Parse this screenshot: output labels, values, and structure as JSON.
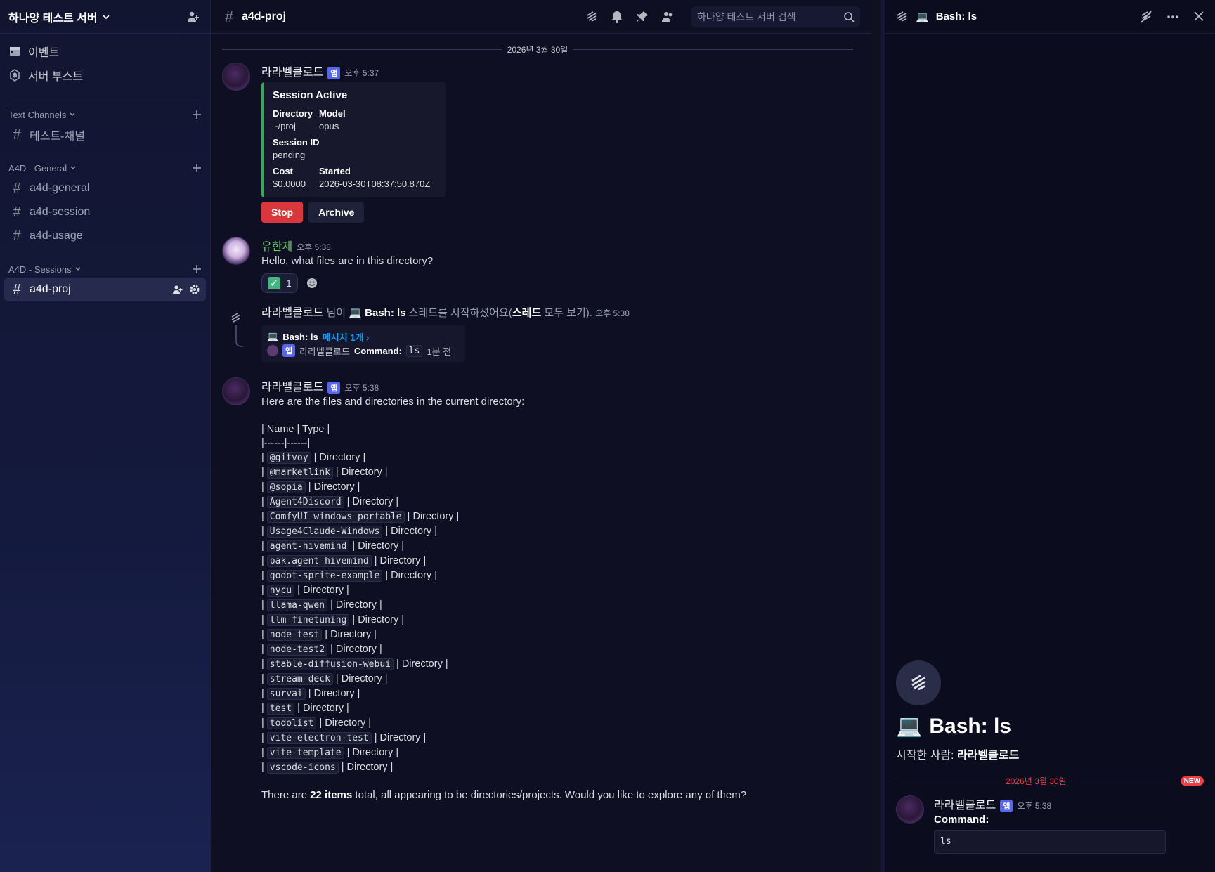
{
  "sidebar": {
    "server_name": "하나양 테스트 서버",
    "top_items": [
      {
        "label": "이벤트",
        "icon": "calendar-icon"
      },
      {
        "label": "서버 부스트",
        "icon": "boost-icon"
      }
    ],
    "categories": [
      {
        "label": "Text Channels",
        "channels": [
          "테스트-채널"
        ]
      },
      {
        "label": "A4D - General",
        "channels": [
          "a4d-general",
          "a4d-session",
          "a4d-usage"
        ]
      },
      {
        "label": "A4D - Sessions",
        "channels": [
          "a4d-proj"
        ]
      }
    ]
  },
  "header": {
    "channel": "a4d-proj",
    "search_placeholder": "하나양 테스트 서버 검색"
  },
  "messages": {
    "date_sep": "2026년 3월 30일",
    "m1": {
      "author": "라라벨클로드",
      "badge": "앱",
      "time": "오후 5:37",
      "embed": {
        "title": "Session Active",
        "directory_label": "Directory",
        "directory": "~/proj",
        "model_label": "Model",
        "model": "opus",
        "session_label": "Session ID",
        "session": "pending",
        "cost_label": "Cost",
        "cost": "$0.0000",
        "started_label": "Started",
        "started": "2026-03-30T08:37:50.870Z"
      },
      "stop": "Stop",
      "archive": "Archive"
    },
    "m2": {
      "author": "유한제",
      "time": "오후 5:38",
      "text": "Hello, what files are in this directory?",
      "reaction_count": "1"
    },
    "m3": {
      "author": "라라벨클로드",
      "mid": "님이",
      "thread_emoji": "💻",
      "thread_name": "Bash: ls",
      "started": "스레드를 시작하셨어요(",
      "all": "스레드",
      "view": "모두 보기).",
      "time": "오후 5:38",
      "card_title": "Bash: ls",
      "card_count": "메시지 1개 ›",
      "card_author": "라라벨클로드",
      "card_badge": "앱",
      "card_cmd": "Command:",
      "card_code": "ls",
      "card_ago": "1분 전"
    },
    "m4": {
      "author": "라라벨클로드",
      "badge": "앱",
      "time": "오후 5:38",
      "intro": "Here are the files and directories in the current directory:",
      "table_header": "| Name | Type |",
      "table_rule": "|------|------|",
      "type_text": "Directory",
      "rows": [
        "@gitvoy",
        "@marketlink",
        "@sopia",
        "Agent4Discord",
        "ComfyUI_windows_portable",
        "Usage4Claude-Windows",
        "agent-hivemind",
        "bak.agent-hivemind",
        "godot-sprite-example",
        "hycu",
        "llama-qwen",
        "llm-finetuning",
        "node-test",
        "node-test2",
        "stable-diffusion-webui",
        "stream-deck",
        "survai",
        "test",
        "todolist",
        "vite-electron-test",
        "vite-template",
        "vscode-icons"
      ],
      "outro_pre": "There are ",
      "outro_bold": "22 items",
      "outro_post": " total, all appearing to be directories/projects. Would you like to explore any of them?"
    }
  },
  "thread_panel": {
    "title": "Bash: ls",
    "emoji": "💻",
    "hero_title": "Bash: ls",
    "started_by_label": "시작한 사람:",
    "started_by": "라라벨클로드",
    "date": "2026년 3월 30일",
    "new": "NEW",
    "msg_author": "라라벨클로드",
    "msg_badge": "앱",
    "msg_time": "오후 5:38",
    "msg_label": "Command:",
    "msg_code": "ls"
  },
  "colors": {
    "accent": "#5865f2",
    "embed_border": "#3ba55c",
    "danger": "#da373c",
    "new_red": "#f23f43"
  }
}
